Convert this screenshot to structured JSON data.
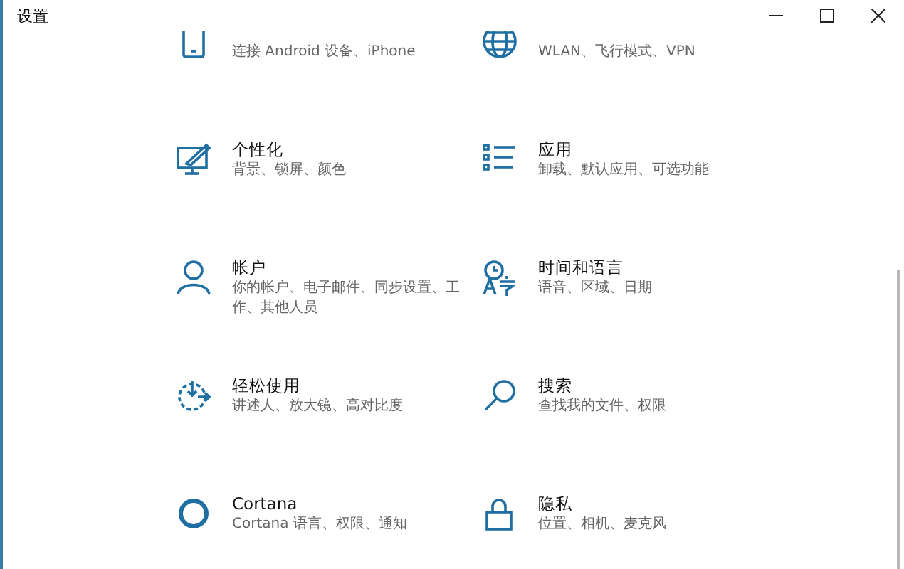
{
  "window": {
    "title": "设置"
  },
  "tiles": [
    {
      "description": "连接 Android 设备、iPhone"
    },
    {
      "description": "WLAN、飞行模式、VPN"
    },
    {
      "title": "个性化",
      "description": "背景、锁屏、颜色"
    },
    {
      "title": "应用",
      "description": "卸载、默认应用、可选功能"
    },
    {
      "title": "帐户",
      "description": "你的帐户、电子邮件、同步设置、工作、其他人员"
    },
    {
      "title": "时间和语言",
      "description": "语音、区域、日期"
    },
    {
      "title": "轻松使用",
      "description": "讲述人、放大镜、高对比度"
    },
    {
      "title": "搜索",
      "description": "查找我的文件、权限"
    },
    {
      "title": "Cortana",
      "description": "Cortana 语言、权限、通知"
    },
    {
      "title": "隐私",
      "description": "位置、相机、麦克风"
    }
  ]
}
